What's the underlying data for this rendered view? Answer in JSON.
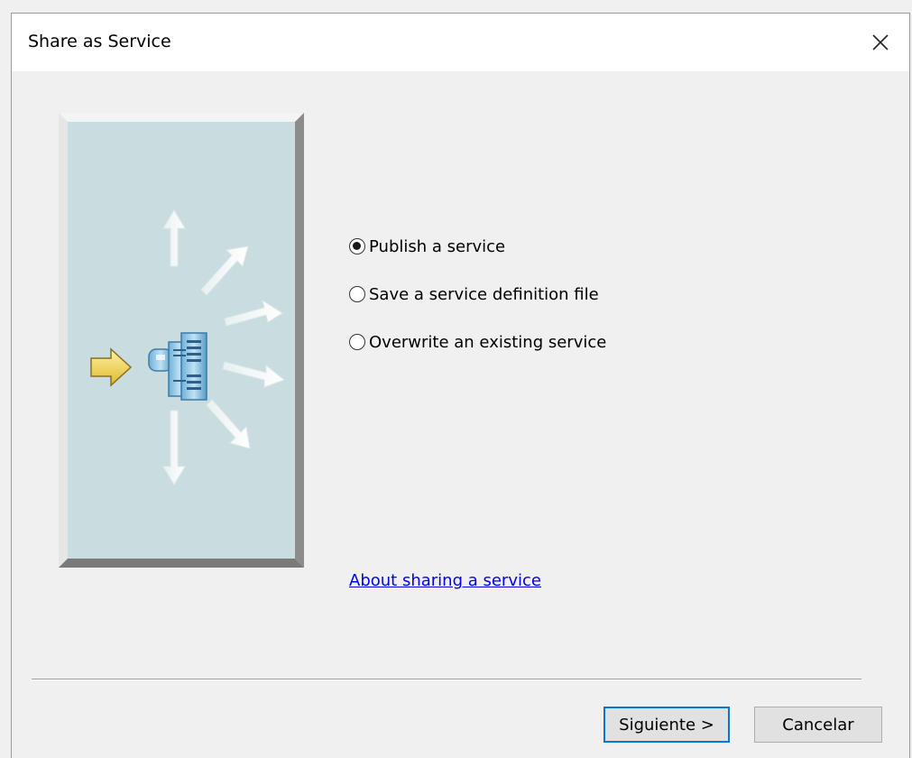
{
  "window": {
    "title": "Share as Service",
    "close_icon": "close-icon"
  },
  "options": [
    {
      "label": "Publish a service",
      "checked": true
    },
    {
      "label": "Save a service definition file",
      "checked": false
    },
    {
      "label": "Overwrite an existing service",
      "checked": false
    }
  ],
  "help_link": "About sharing a service",
  "buttons": {
    "next": "Siguiente >",
    "cancel": "Cancelar"
  },
  "colors": {
    "illustration_bg": "#c9dcdf",
    "accent": "#0078d7",
    "link": "#0000ee"
  }
}
